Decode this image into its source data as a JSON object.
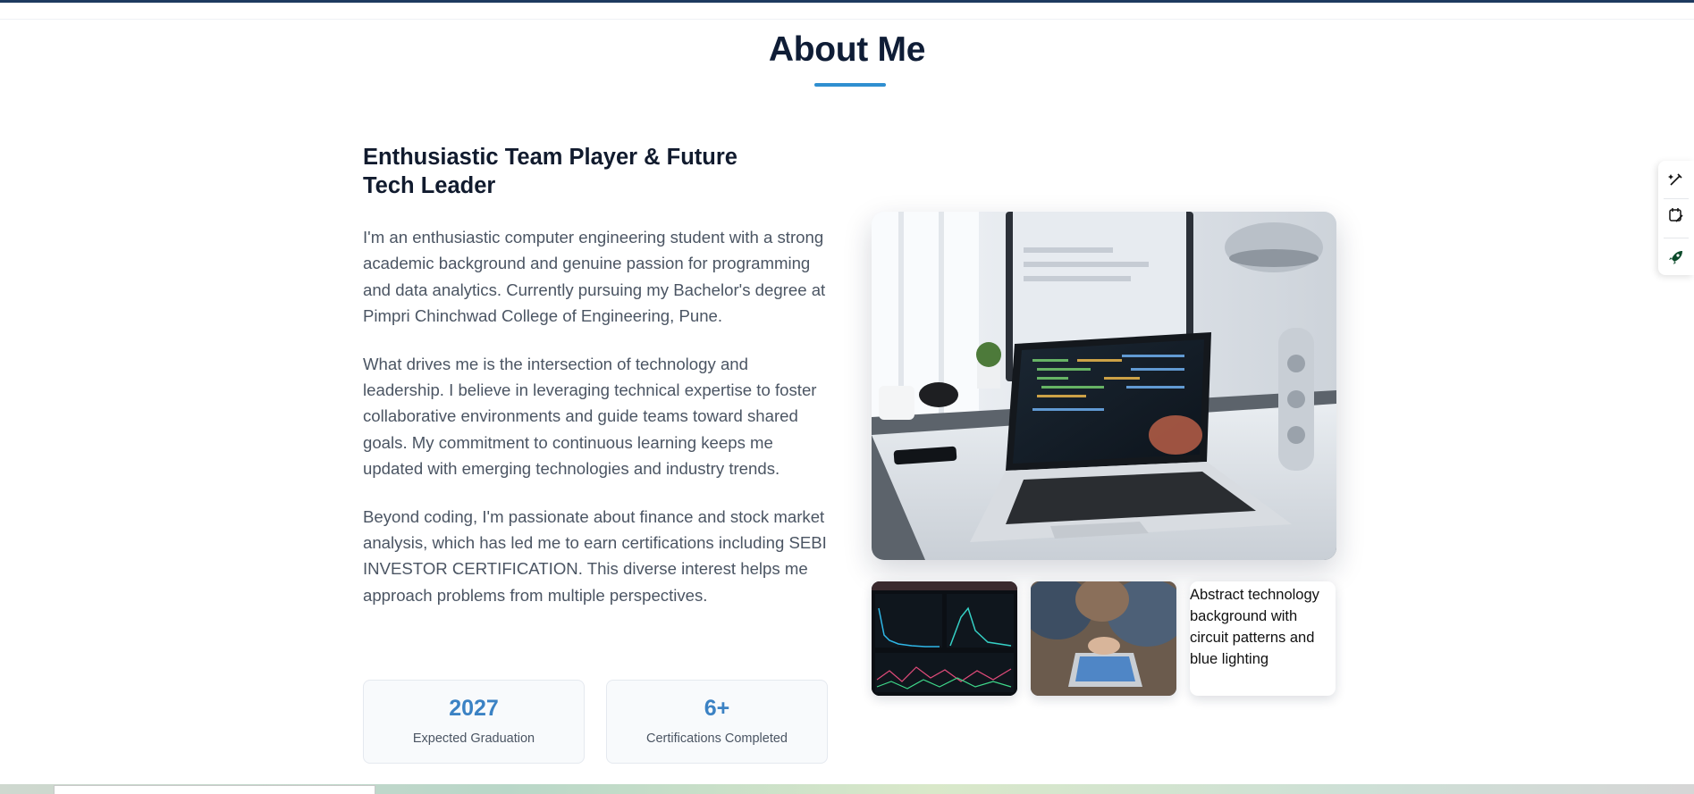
{
  "section": {
    "title": "About Me"
  },
  "about": {
    "subheading": "Enthusiastic Team Player & Future Tech Leader",
    "paragraphs": [
      "I'm an enthusiastic computer engineering student with a strong academic background and genuine passion for programming and data analytics. Currently pursuing my Bachelor's degree at Pimpri Chinchwad College of Engineering, Pune.",
      "What drives me is the intersection of technology and leadership. I believe in leveraging technical expertise to foster collaborative environments and guide teams toward shared goals. My commitment to continuous learning keeps me updated with emerging technologies and industry trends.",
      "Beyond coding, I'm passionate about finance and stock market analysis, which has led me to earn certifications including SEBI INVESTOR CERTIFICATION. This diverse interest helps me approach problems from multiple perspectives."
    ],
    "stats": [
      {
        "value": "2027",
        "label": "Expected Graduation"
      },
      {
        "value": "6+",
        "label": "Certifications Completed"
      }
    ]
  },
  "gallery": {
    "broken_image_alt": "Abstract technology background with circuit patterns and blue lighting"
  },
  "side_dock": {
    "icons": [
      "magic-pen-icon",
      "calendar-edit-icon",
      "rocket-icon"
    ]
  },
  "colors": {
    "accent": "#2f8fd0",
    "stat_value": "#3b82c4",
    "heading": "#0f1d36"
  }
}
